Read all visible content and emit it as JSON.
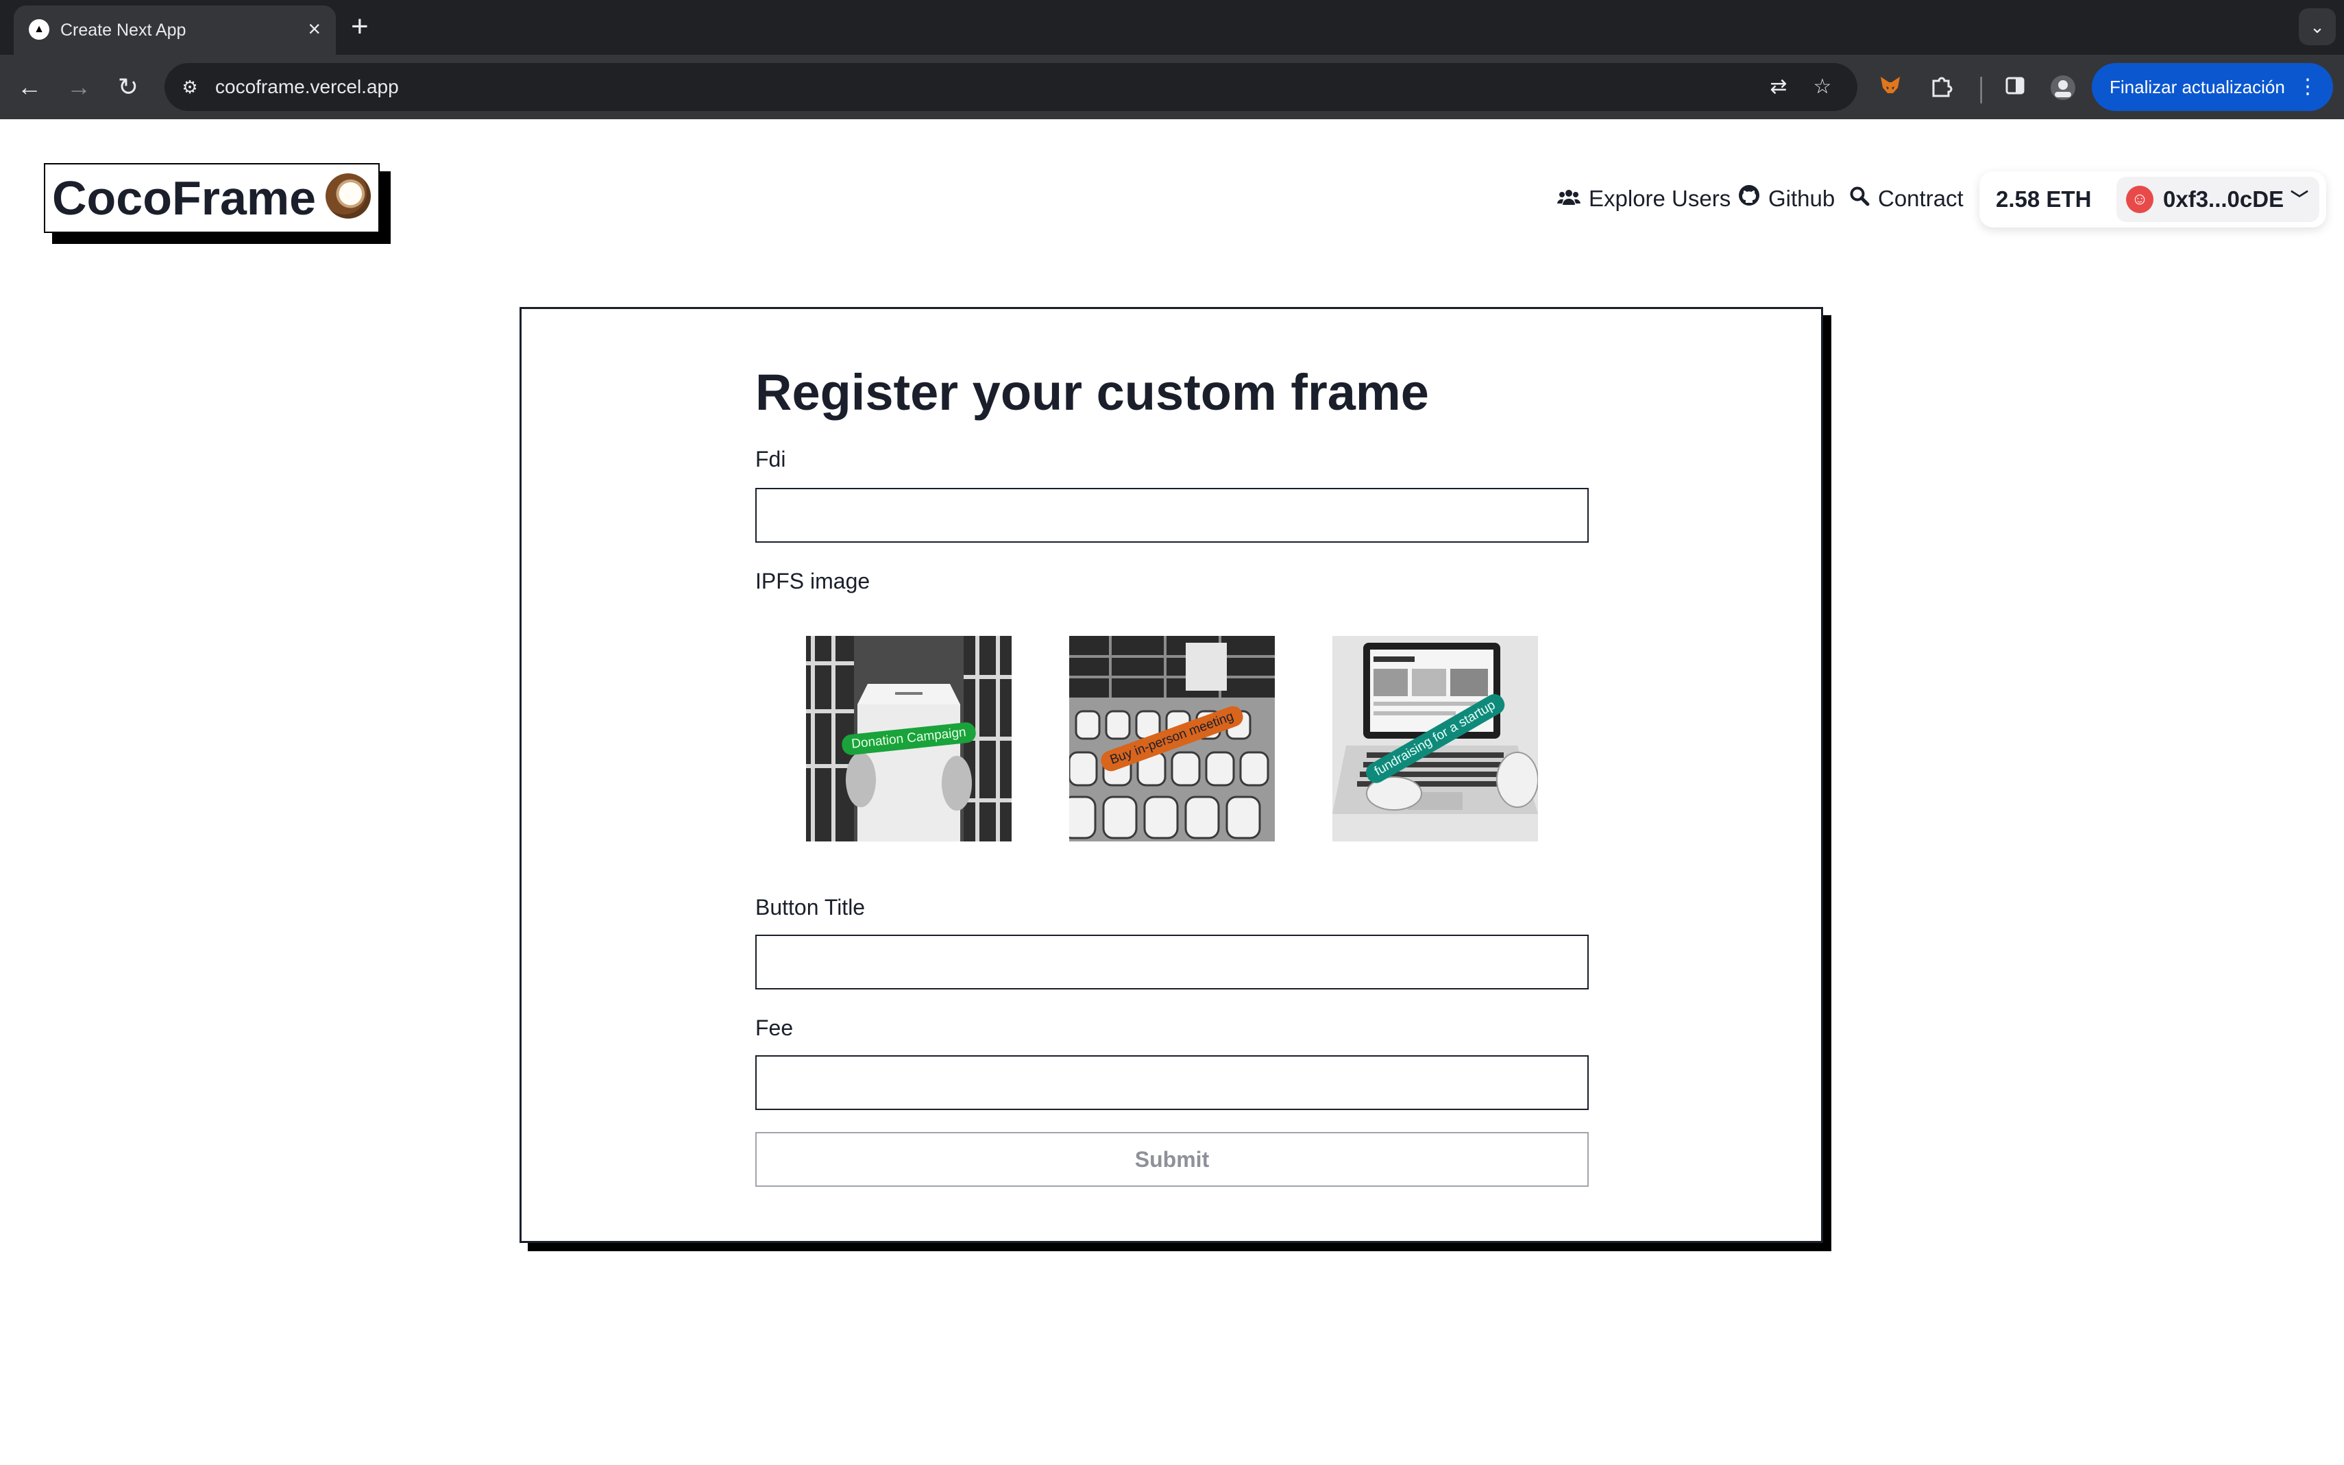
{
  "browser": {
    "tab_title": "Create Next App",
    "new_tab_glyph": "+",
    "close_glyph": "×",
    "url": "cocoframe.vercel.app",
    "update_label": "Finalizar actualización"
  },
  "header": {
    "logo_text": "CocoFrame",
    "nav": {
      "explore_users": "Explore Users",
      "github": "Github",
      "contract": "Contract"
    },
    "wallet": {
      "balance": "2.58 ETH",
      "address": "0xf3...0cDE"
    }
  },
  "form": {
    "title": "Register your custom frame",
    "fdi_label": "Fdi",
    "fdi_value": "",
    "ipfs_label": "IPFS image",
    "images": [
      {
        "caption": "Donation Campaign",
        "tag_color": "#19a33a"
      },
      {
        "caption": "Buy in-person meeting",
        "tag_color": "#d9641c"
      },
      {
        "caption": "fundraising for a startup",
        "tag_color": "#0f8a7a"
      }
    ],
    "button_title_label": "Button Title",
    "button_title_value": "",
    "fee_label": "Fee",
    "fee_value": "",
    "submit_label": "Submit"
  },
  "colors": {
    "accent": "#0b57d0",
    "text": "#1a1f2b",
    "avatar": "#e84a4a"
  }
}
